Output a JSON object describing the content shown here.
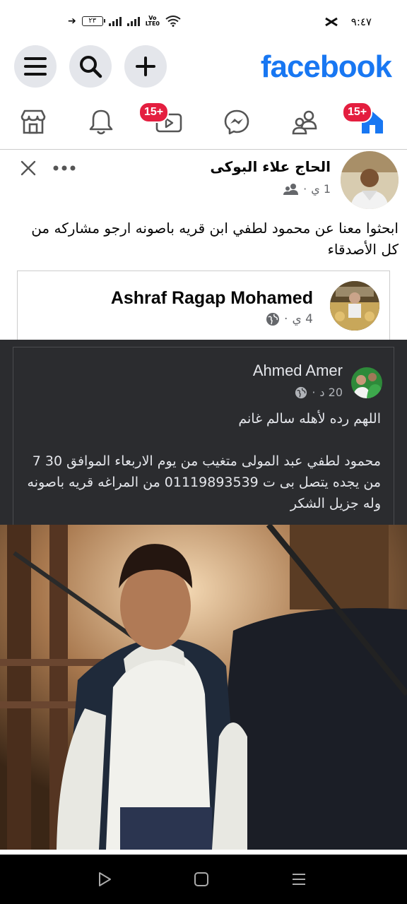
{
  "status_bar": {
    "time": "٩:٤٧",
    "battery": "٢٣",
    "network_label_1": "Vo",
    "network_label_2": "LTE0"
  },
  "header": {
    "logo": "facebook",
    "icons": [
      "menu-icon",
      "search-icon",
      "plus-icon"
    ]
  },
  "nav": {
    "tabs": [
      {
        "name": "home",
        "icon": "home-icon",
        "badge": "15+"
      },
      {
        "name": "friends",
        "icon": "friends-icon"
      },
      {
        "name": "messenger",
        "icon": "messenger-icon"
      },
      {
        "name": "watch",
        "icon": "video-icon",
        "badge": "15+"
      },
      {
        "name": "notifications",
        "icon": "bell-icon"
      },
      {
        "name": "marketplace",
        "icon": "store-icon"
      }
    ],
    "home_badge": "15+",
    "watch_badge": "15+"
  },
  "post": {
    "author": "الحاج علاء البوكى",
    "time": "1 ي",
    "separator": "·",
    "text": "ابحثوا  معنا  عن محمود لطفي ابن قريه باصونه  ارجو مشاركه من كل الأصدقاء",
    "shared": {
      "author": "Ashraf Ragap Mohamed",
      "time": "4 ي",
      "separator": "·",
      "inner": {
        "author": "Ahmed Amer",
        "time": "20 د",
        "separator": "·",
        "line1": "اللهم رده لأهله سالم غانم",
        "line2": "محمود لطفي عبد المولى متغيب من يوم الاربعاء الموافق 30 7 من يجده يتصل بى ت 01119893539 من المراغه قريه باصونه وله جزيل الشكر"
      }
    }
  },
  "colors": {
    "brand": "#1877f2",
    "badge": "#e41e3f",
    "dark_bg": "#2b2c2f"
  }
}
